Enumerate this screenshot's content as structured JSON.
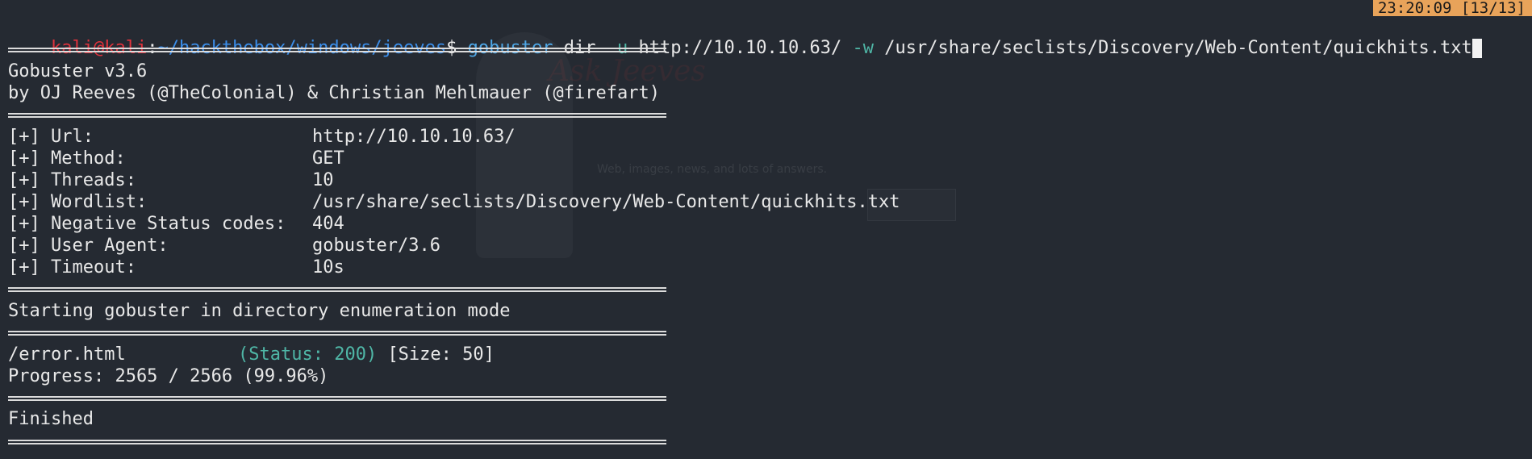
{
  "clock": "23:20:09 [13/13]",
  "prompt": {
    "user": "kali",
    "at": "@",
    "host": "kali",
    "colon": ":",
    "cwd": "~/hackthebox/windows/jeeves",
    "symbol": "$"
  },
  "command": {
    "program": "gobuster",
    "arg1": "dir",
    "flag_u": "-u",
    "url": "http://10.10.10.63/",
    "flag_w": "-w",
    "wordlist": "/usr/share/seclists/Discovery/Web-Content/quickhits.txt"
  },
  "banner": {
    "version": "Gobuster v3.6",
    "authors": "by OJ Reeves (@TheColonial) & Christian Mehlmauer (@firefart)"
  },
  "config": [
    {
      "label": "[+] Url:",
      "value": "http://10.10.10.63/"
    },
    {
      "label": "[+] Method:",
      "value": "GET"
    },
    {
      "label": "[+] Threads:",
      "value": "10"
    },
    {
      "label": "[+] Wordlist:",
      "value": "/usr/share/seclists/Discovery/Web-Content/quickhits.txt"
    },
    {
      "label": "[+] Negative Status codes:",
      "value": "404"
    },
    {
      "label": "[+] User Agent:",
      "value": "gobuster/3.6"
    },
    {
      "label": "[+] Timeout:",
      "value": "10s"
    }
  ],
  "mode_message": "Starting gobuster in directory enumeration mode",
  "result": {
    "path": "/error.html",
    "status": "(Status: 200)",
    "size": "[Size: 50]"
  },
  "progress": "Progress: 2565 / 2566 (99.96%)",
  "finished": "Finished",
  "background_ghost": {
    "logo": "Ask Jeeves",
    "text": "Web, images, news, and lots of answers."
  }
}
